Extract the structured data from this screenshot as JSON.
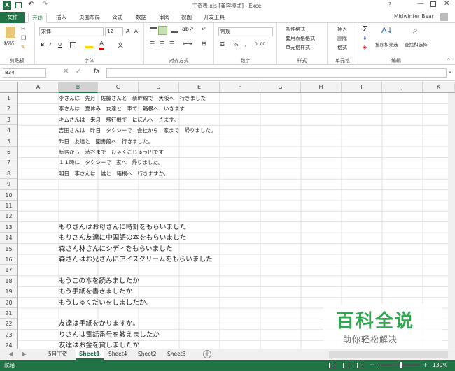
{
  "window": {
    "title": "工资表.xls  [兼容模式] - Excel",
    "user": "Midwinter Bear"
  },
  "tabs": [
    "文件",
    "开始",
    "插入",
    "页面布局",
    "公式",
    "数据",
    "审阅",
    "视图",
    "开发工具"
  ],
  "ribbon": {
    "clipboard": {
      "paste": "粘贴",
      "label": "剪贴板"
    },
    "font": {
      "name": "宋体",
      "size": "12",
      "label": "字体",
      "bold": "B",
      "italic": "I",
      "underline": "U"
    },
    "alignment": {
      "label": "对齐方式"
    },
    "number": {
      "format": "常规",
      "label": "数字",
      "percent": "%",
      "comma": ","
    },
    "styles": {
      "cond": "条件格式",
      "table": "套用表格格式",
      "cell": "单元格样式",
      "label": "样式"
    },
    "cells": {
      "insert": "插入",
      "delete": "删除",
      "format": "格式",
      "label": "单元格"
    },
    "editing": {
      "sort": "排序和筛选",
      "find": "查找和选择",
      "label": "编辑"
    }
  },
  "formula_bar": {
    "namebox": "B34",
    "fx": "fx",
    "content": ""
  },
  "columns": [
    "A",
    "B",
    "C",
    "D",
    "E",
    "F",
    "G",
    "H",
    "I",
    "J",
    "K"
  ],
  "rows": [
    "1",
    "2",
    "3",
    "4",
    "5",
    "6",
    "7",
    "8",
    "9",
    "10",
    "11",
    "12",
    "13",
    "14",
    "15",
    "16",
    "17",
    "18",
    "19",
    "20",
    "21",
    "22",
    "23",
    "24"
  ],
  "cells": [
    {
      "row": 1,
      "text": "李さんは　先月　佐藤さんと　新幹線で　大阪へ　行きました"
    },
    {
      "row": 2,
      "text": "李さんは　夏休み　友達と　車で　箱根へ　いきます"
    },
    {
      "row": 3,
      "text": "キムさんは　来月　飛行機で　にほんへ　きます。"
    },
    {
      "row": 4,
      "text": "吉田さんは　昨日　タクシーで　会社から　家まで　帰りました。"
    },
    {
      "row": 5,
      "text": "昨日　友達と　図書館へ　行きました。"
    },
    {
      "row": 6,
      "text": "新宿から　渋谷まで　ひゃくごじゅう円です"
    },
    {
      "row": 7,
      "text": "１１時に　タクシーで　家へ　帰りました。"
    },
    {
      "row": 8,
      "text": "明日　李さんは　誰と　箱根へ　行きますか。"
    },
    {
      "row": 13,
      "text": "もりさんはお母さんに時計をもらいました"
    },
    {
      "row": 14,
      "text": "もりさん友達に中国語の本をもらいました"
    },
    {
      "row": 15,
      "text": "森さん林さんにシディをもらいました"
    },
    {
      "row": 16,
      "text": "森さんはお兄さんにアイスクリームをもらいました"
    },
    {
      "row": 18,
      "text": "もうこの本を読みましたか"
    },
    {
      "row": 19,
      "text": "もう手紙を書きましたか"
    },
    {
      "row": 20,
      "text": "もうしゅくだいをしましたか。"
    },
    {
      "row": 22,
      "text": "友達は手紙をかりますか。"
    },
    {
      "row": 23,
      "text": "りさんは電話番号を教えましたか"
    },
    {
      "row": 24,
      "text": "友達はお金を貸しましたか"
    }
  ],
  "sheets": [
    "5月工资",
    "Sheet1",
    "Sheet4",
    "Sheet2",
    "Sheet3"
  ],
  "active_sheet": "Sheet1",
  "status": {
    "ready": "就绪",
    "zoom": "130%"
  },
  "watermark": {
    "main": "百科全说",
    "sub": "助你轻松解决"
  }
}
